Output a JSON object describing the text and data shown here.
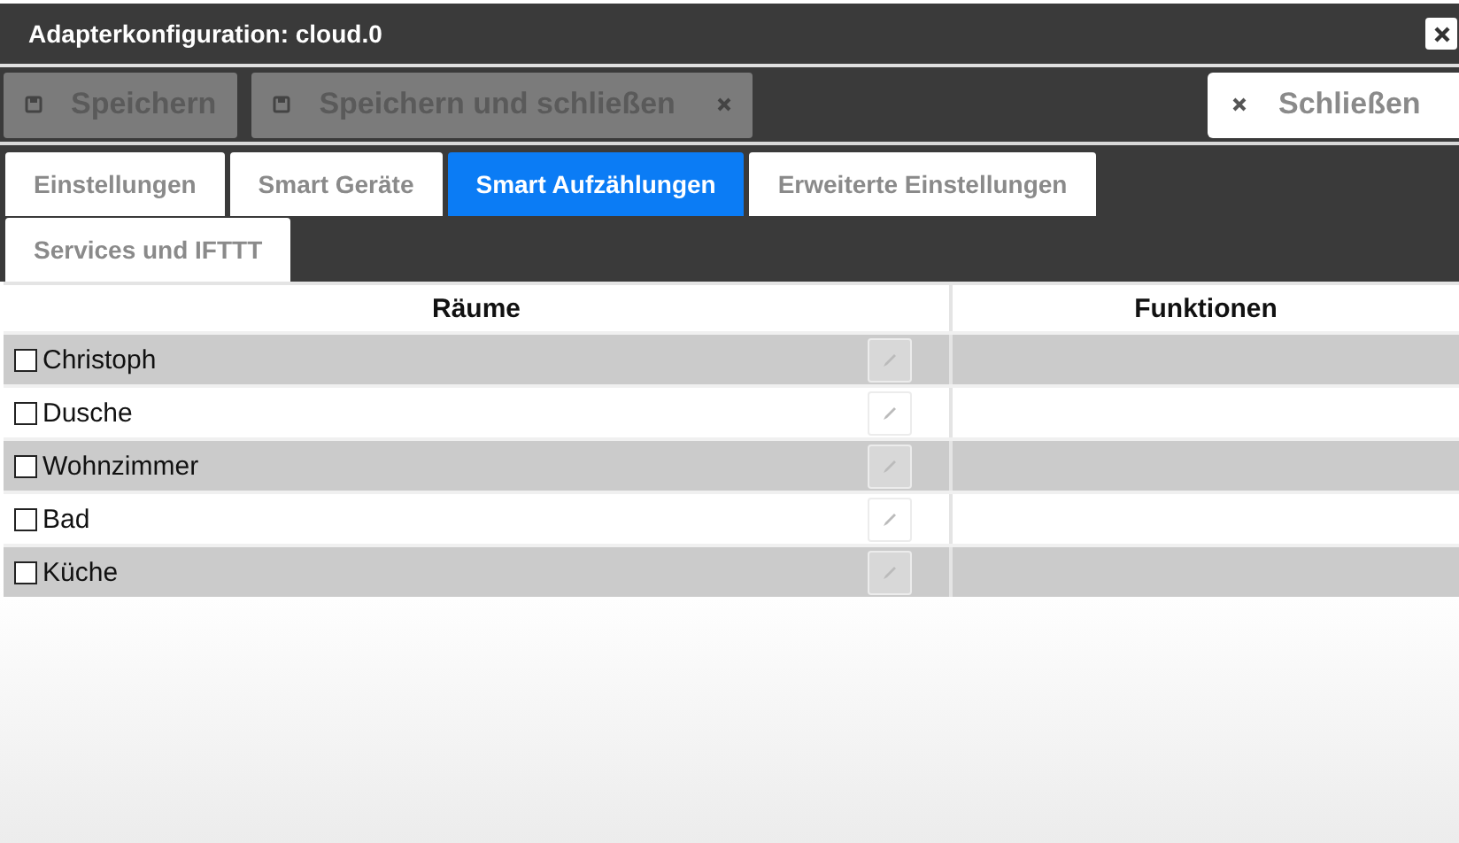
{
  "window": {
    "title": "Adapterkonfiguration: cloud.0"
  },
  "toolbar": {
    "buttons": [
      {
        "label": "Speichern",
        "kind": "save",
        "disabled": true
      },
      {
        "label": "Speichern und schließen",
        "kind": "save-close",
        "disabled": true
      }
    ],
    "close_button": {
      "label": "Schließen",
      "disabled": false
    }
  },
  "tabs": [
    {
      "label": "Einstellungen",
      "selected": false
    },
    {
      "label": "Smart Geräte",
      "selected": false
    },
    {
      "label": "Smart Aufzählungen",
      "selected": true
    },
    {
      "label": "Erweiterte Einstellungen",
      "selected": false
    },
    {
      "label": "Services und IFTTT",
      "selected": false
    }
  ],
  "table": {
    "columns": [
      "Räume",
      "Funktionen"
    ],
    "rows": [
      {
        "name": "Christoph",
        "checked": false
      },
      {
        "name": "Dusche",
        "checked": false
      },
      {
        "name": "Wohnzimmer",
        "checked": false
      },
      {
        "name": "Bad",
        "checked": false
      },
      {
        "name": "Küche",
        "checked": false
      }
    ]
  }
}
